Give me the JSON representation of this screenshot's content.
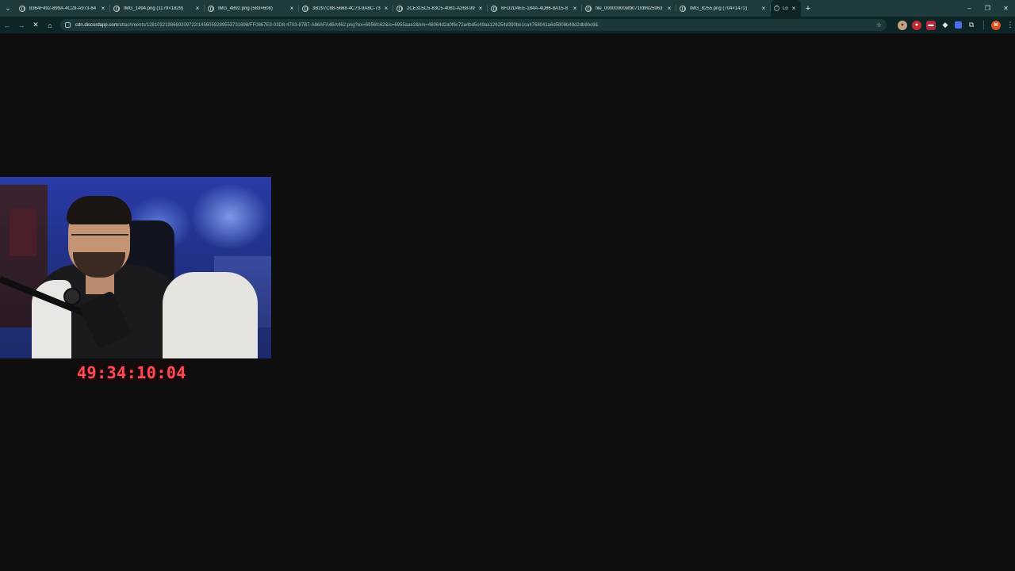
{
  "browser": {
    "tabs": [
      {
        "title": "8364F492-899A-4C29-A973-64",
        "close": "×"
      },
      {
        "title": "IMG_1494.png (1179×1829)",
        "close": "×"
      },
      {
        "title": "IMG_4892.png (583×608)",
        "close": "×"
      },
      {
        "title": "3B297C88-5668-4C73-9A8C-73",
        "close": "×"
      },
      {
        "title": "2CE315C5-83C5-4081-A268-99",
        "close": "×"
      },
      {
        "title": "6FD2D4EE-184A-4D86-8A15-8",
        "close": "×"
      },
      {
        "title": "file_00000000efb071fd9925963",
        "close": "×"
      },
      {
        "title": "IMG_8255.png (704×1472)",
        "close": "×"
      }
    ],
    "active_tab": {
      "title": "Lo",
      "close": "×"
    },
    "new_tab_label": "+",
    "window_controls": {
      "minimize": "–",
      "restore": "❐",
      "close": "✕"
    },
    "toolbar": {
      "back": "←",
      "forward": "→",
      "reload": "✕",
      "home": "⌂",
      "url_host": "cdn.discordapp.com",
      "url_path": "/attachments/1281032198669209722/1456059289553731698/FF0867E9-03D8-4703-87B7-A86AFA4BA462.png?ex=6956fc62&is=6955aae2&hm=48064d2a0f6c72a4bd5c49aa126254d390be1ca4768041a6d5808b48d2db8bc6&",
      "star": "☆"
    },
    "profile_initial": "M"
  },
  "content": {
    "timer_text": "49:34:10:04"
  },
  "colors": {
    "tabbar_bg": "#1f3a3d",
    "toolbar_bg": "#0d2527",
    "page_bg": "#0e0e0e",
    "timer": "#ff4a55"
  }
}
